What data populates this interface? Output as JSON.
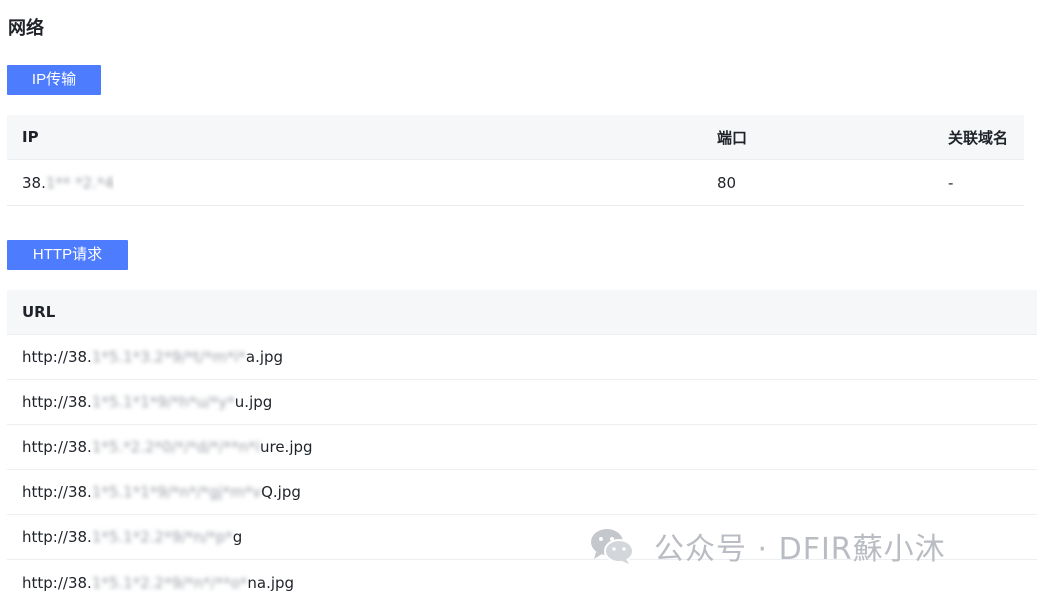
{
  "section": {
    "title": "网络"
  },
  "ip_section": {
    "tag_label": "IP传输",
    "headers": {
      "ip": "IP",
      "port": "端口",
      "domain": "关联域名"
    },
    "rows": [
      {
        "ip_prefix": "38.",
        "ip_masked": "1** *2.*4",
        "port": "80",
        "domain": "-"
      }
    ]
  },
  "http_section": {
    "tag_label": "HTTP请求",
    "headers": {
      "url": "URL"
    },
    "rows": [
      {
        "prefix": "http://38.",
        "masked": "1*5.1*3.2*9/*t/*m*i*",
        "suffix": "a.jpg"
      },
      {
        "prefix": "http://38.",
        "masked": "1*5.1*1*9/*h*u/*y*",
        "suffix": "u.jpg"
      },
      {
        "prefix": "http://38.",
        "masked": "1*5.*2.2*0/*/*d/*/**n*i",
        "suffix": "ure.jpg"
      },
      {
        "prefix": "http://38.",
        "masked": "1*5.1*1*9/*n*/*gj*m*v",
        "suffix": "Q.jpg"
      },
      {
        "prefix": "http://38.",
        "masked": "1*5.1*2.2*9/*n/*p*",
        "suffix": "g"
      },
      {
        "prefix": "http://38.",
        "masked": "1*5.1*2.2*9/*n*/**o*",
        "suffix": "na.jpg"
      }
    ]
  },
  "watermark": {
    "text": "公众号 · DFIR蘇小沐",
    "icon": "wechat-icon"
  },
  "colors": {
    "accent": "#4d7cff",
    "header_bg": "#f6f7f9",
    "border": "#eceef2",
    "watermark": "#b9bcc2"
  }
}
